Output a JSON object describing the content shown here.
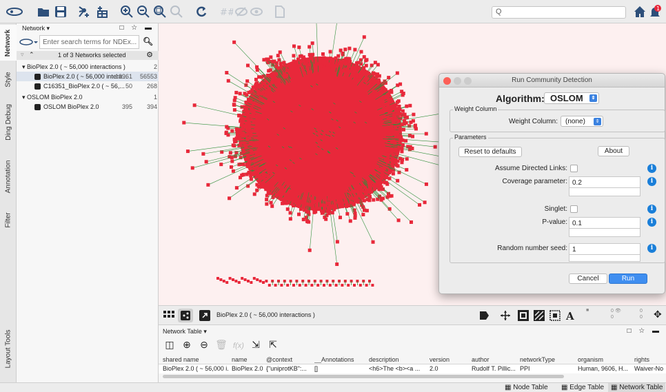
{
  "toolbar": {
    "search_placeholder": "Q",
    "notification_count": "1",
    "icons": [
      "ndex-logo-icon",
      "open-folder-icon",
      "save-icon",
      "import-network-icon",
      "import-table-icon",
      "zoom-in-icon",
      "zoom-out-icon",
      "zoom-fit-icon",
      "zoom-selected-icon",
      "refresh-icon",
      "hide-icon",
      "show-icon",
      "export-icon",
      "home-icon",
      "notification-icon"
    ]
  },
  "vtabs": [
    "Network",
    "Style",
    "Ding Debug",
    "Annotation",
    "Filter",
    "Layout Tools"
  ],
  "network_panel": {
    "header": "Network ▾",
    "ndex_placeholder": "Enter search terms for NDEx...",
    "selection_text": "1 of 3 Networks selected",
    "tree": [
      {
        "label": "BioPlex 2.0 ( ~ 56,000 interactions )",
        "n1": "",
        "n2": "2",
        "level": 0
      },
      {
        "label": "BioPlex 2.0 ( ~ 56,000 intera...",
        "n1": "10961",
        "n2": "56553",
        "level": 1
      },
      {
        "label": "C16351_BioPlex 2.0 ( ~ 56,...",
        "n1": "50",
        "n2": "268",
        "level": 1
      },
      {
        "label": "OSLOM BioPlex 2.0",
        "n1": "",
        "n2": "1",
        "level": 0
      },
      {
        "label": "OSLOM BioPlex 2.0",
        "n1": "395",
        "n2": "394",
        "level": 1
      }
    ]
  },
  "canvas_bar": {
    "network_title": "BioPlex 2.0 ( ~ 56,000 interactions )",
    "counts_a": "0 👁\n0",
    "counts_b": "0\n0"
  },
  "table": {
    "header": "Network Table ▾",
    "columns": [
      "shared name",
      "name",
      "@context",
      "__Annotations",
      "description",
      "version",
      "author",
      "networkType",
      "organism",
      "rights"
    ],
    "row": [
      "BioPlex 2.0 ( ~ 56,000 i...",
      "BioPlex 2.0 (...",
      "{\"uniprotKB\":...",
      "[]",
      "<h6>The <b><a ...",
      "2.0",
      "Rudolf T. Pillic...",
      "PPI",
      "Human, 9606, H...",
      "Waiver-No r"
    ]
  },
  "statusbar": {
    "tabs": [
      "Node Table",
      "Edge Table",
      "Network Table"
    ]
  },
  "dialog": {
    "title": "Run Community Detection",
    "algorithm_label": "Algorithm:",
    "algorithm_value": "OSLOM",
    "weight_group": "Weight Column",
    "weight_label": "Weight Column:",
    "weight_value": "(none)",
    "params_group": "Parameters",
    "reset_label": "Reset to defaults",
    "about_label": "About",
    "directed_label": "Assume Directed Links:",
    "coverage_label": "Coverage parameter:",
    "coverage_value": "0.2",
    "singlet_label": "Singlet:",
    "pvalue_label": "P-value:",
    "pvalue_value": "0.1",
    "seed_label": "Random number seed:",
    "seed_value": "1",
    "cancel_label": "Cancel",
    "run_label": "Run"
  },
  "colors": {
    "node": "#e8283a",
    "edge": "#2f8f3a",
    "accent": "#1a7fd9",
    "canvas_bg": "#fdf0f0"
  }
}
